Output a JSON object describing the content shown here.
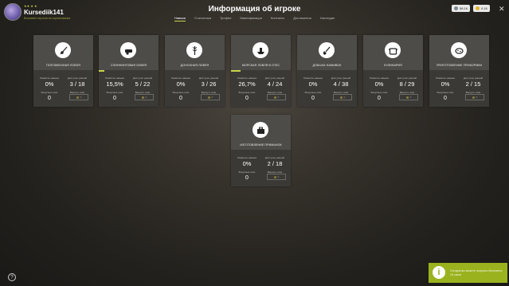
{
  "header": {
    "username": "Kursediik141",
    "subline": "Вызывает игроков на соревнование",
    "level_stars": "★★ ★ ★",
    "title": "Информация об игроке",
    "currency1": "58.16",
    "currency2": "0.16",
    "close_glyph": "✕"
  },
  "tabs": [
    "Навыки",
    "Статистика",
    "Трофеи",
    "Квалификации",
    "Контакты",
    "Достижения",
    "Наследие"
  ],
  "labels": {
    "level": "Развитие навыка",
    "points": "Доступно умений",
    "bonus": "Бонусные очки",
    "refund": "Вернуть очки"
  },
  "skills": [
    {
      "name": "ПОПЛАВОЧНАЯ ЛОВЛЯ",
      "percent": "0%",
      "progress_pct": 0,
      "points": "3 / 18",
      "bonus": "0",
      "refund": "0",
      "icon": "float-rod-icon"
    },
    {
      "name": "СПИННИНГОВАЯ ЛОВЛЯ",
      "percent": "15,5%",
      "progress_pct": 15.5,
      "points": "5 / 22",
      "bonus": "0",
      "refund": "0",
      "icon": "spinning-reel-icon"
    },
    {
      "name": "ДОНОЧНАЯ ЛОВЛЯ",
      "percent": "0%",
      "progress_pct": 0,
      "points": "3 / 26",
      "bonus": "0",
      "refund": "0",
      "icon": "bottom-rod-icon"
    },
    {
      "name": "МОРСКАЯ ЛОВЛЯ В ОТКС",
      "percent": "26,7%",
      "progress_pct": 26.7,
      "points": "4 / 24",
      "bonus": "0",
      "refund": "0",
      "icon": "sea-boat-icon"
    },
    {
      "name": "ДОБЫЧА НАЖИВОК",
      "percent": "0%",
      "progress_pct": 0,
      "points": "4 / 38",
      "bonus": "0",
      "refund": "0",
      "icon": "shovel-icon"
    },
    {
      "name": "КУЛИНАРИЯ",
      "percent": "0%",
      "progress_pct": 0,
      "points": "8 / 29",
      "bonus": "0",
      "refund": "0",
      "icon": "pot-icon"
    },
    {
      "name": "ПРИГОТОВЛЕНИЕ ПРИКОРМКИ",
      "percent": "0%",
      "progress_pct": 0,
      "points": "2 / 15",
      "bonus": "0",
      "refund": "0",
      "icon": "groundbait-icon"
    },
    {
      "name": "ИЗГОТОВЛЕНИЕ ПРИМАНОК",
      "percent": "0%",
      "progress_pct": 0,
      "points": "2 / 18",
      "bonus": "0",
      "refund": "0",
      "icon": "toolbox-icon"
    }
  ],
  "help_glyph": "?",
  "toast": {
    "icon": "i",
    "text": "Сегодня вы можете получить бесплатно 16 очков"
  }
}
